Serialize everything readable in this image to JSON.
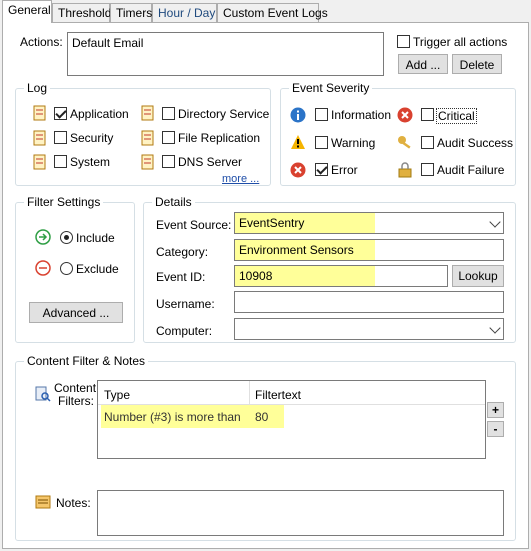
{
  "tabs": [
    "General",
    "Threshold",
    "Timers",
    "Hour / Day",
    "Custom Event Logs"
  ],
  "actions": {
    "label": "Actions:",
    "value": "Default Email",
    "trigger_all": "Trigger all actions",
    "add": "Add ...",
    "delete": "Delete"
  },
  "log": {
    "title": "Log",
    "items": [
      "Application",
      "Security",
      "System",
      "Directory Service",
      "File Replication",
      "DNS Server"
    ],
    "more": "more ..."
  },
  "severity": {
    "title": "Event Severity",
    "items": [
      "Information",
      "Warning",
      "Error",
      "Critical",
      "Audit Success",
      "Audit Failure"
    ]
  },
  "filter": {
    "title": "Filter Settings",
    "include": "Include",
    "exclude": "Exclude",
    "advanced": "Advanced ..."
  },
  "details": {
    "title": "Details",
    "source_label": "Event Source:",
    "source_value": "EventSentry",
    "category_label": "Category:",
    "category_value": "Environment Sensors",
    "eventid_label": "Event ID:",
    "eventid_value": "10908",
    "lookup": "Lookup",
    "username_label": "Username:",
    "computer_label": "Computer:"
  },
  "content": {
    "title": "Content Filter & Notes",
    "filters_label": "Content Filters:",
    "col_type": "Type",
    "col_filtertext": "Filtertext",
    "row_type": "Number (#3) is more than",
    "row_text": "80",
    "plus": "+",
    "minus": "-",
    "notes_label": "Notes:"
  },
  "colors": {
    "highlight": "#ffff99",
    "accent": "#1f4a7e"
  }
}
